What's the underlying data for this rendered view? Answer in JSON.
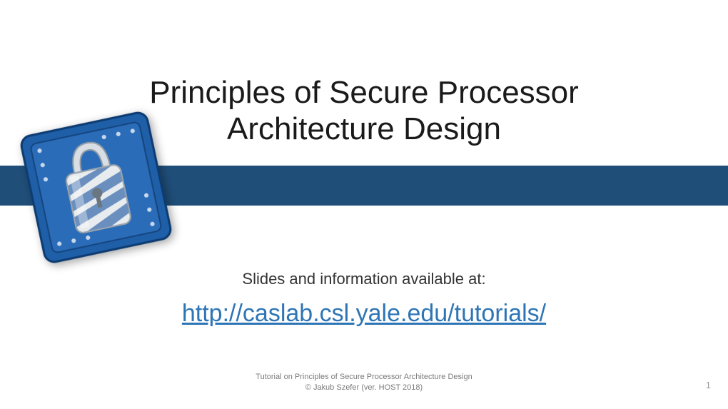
{
  "title_line1": "Principles of Secure Processor",
  "title_line2": "Architecture Design",
  "subtitle": "Slides and information available at:",
  "link_text": "http://caslab.csl.yale.edu/tutorials/",
  "link_href": "http://caslab.csl.yale.edu/tutorials/",
  "footer_line1": "Tutorial on Principles of Secure Processor Architecture Design",
  "footer_line2": "© Jakub Szefer (ver. HOST 2018)",
  "page_number": "1",
  "icon": {
    "name": "chip-lock-icon",
    "chip_color": "#1f5fa8",
    "chip_edge": "#0d3c72",
    "lock_body": "#cfd6dc",
    "lock_shackle": "#b8c0c7",
    "stripe": "#4a78b3"
  }
}
